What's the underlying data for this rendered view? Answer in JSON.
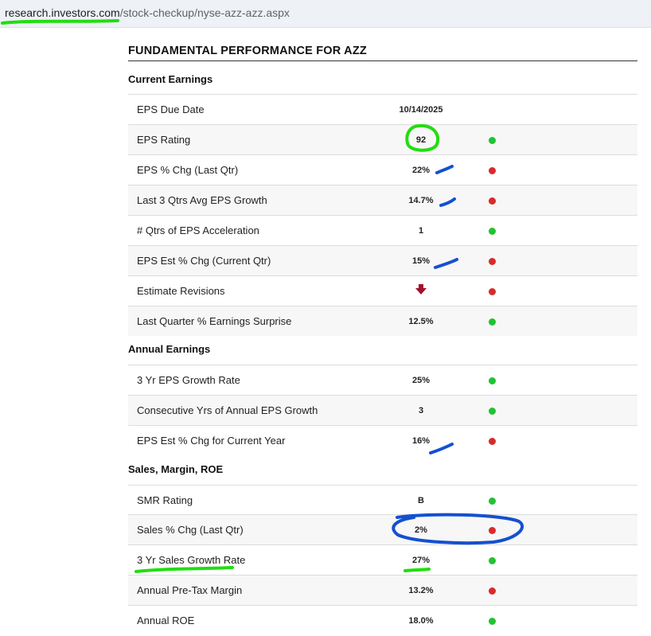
{
  "browser": {
    "url_host": "research.investors.com",
    "url_path": "/stock-checkup/nyse-azz-azz.aspx"
  },
  "page": {
    "title": "FUNDAMENTAL PERFORMANCE FOR AZZ"
  },
  "colors": {
    "good": "#22c232",
    "bad": "#d92b2b",
    "down_arrow": "#a3102a",
    "ink_green": "#22dd11",
    "ink_blue": "#1450d0"
  },
  "sections": {
    "current": {
      "heading": "Current Earnings",
      "rows": [
        {
          "label": "EPS Due Date",
          "value": "10/14/2025",
          "status": ""
        },
        {
          "label": "EPS Rating",
          "value": "92",
          "status": "good"
        },
        {
          "label": "EPS % Chg (Last Qtr)",
          "value": "22%",
          "status": "bad"
        },
        {
          "label": "Last 3 Qtrs Avg EPS Growth",
          "value": "14.7%",
          "status": "bad"
        },
        {
          "label": "# Qtrs of EPS Acceleration",
          "value": "1",
          "status": "good"
        },
        {
          "label": "EPS Est % Chg (Current Qtr)",
          "value": "15%",
          "status": "bad"
        },
        {
          "label": "Estimate Revisions",
          "value": "",
          "icon": "down-arrow-icon",
          "status": "bad"
        },
        {
          "label": "Last Quarter % Earnings Surprise",
          "value": "12.5%",
          "status": "good"
        }
      ]
    },
    "annual": {
      "heading": "Annual Earnings",
      "rows": [
        {
          "label": "3 Yr EPS Growth Rate",
          "value": "25%",
          "status": "good"
        },
        {
          "label": "Consecutive Yrs of Annual EPS Growth",
          "value": "3",
          "status": "good"
        },
        {
          "label": "EPS Est % Chg for Current Year",
          "value": "16%",
          "status": "bad"
        }
      ]
    },
    "smr": {
      "heading": "Sales, Margin, ROE",
      "rows": [
        {
          "label": "SMR Rating",
          "value": "B",
          "status": "good"
        },
        {
          "label": "Sales % Chg (Last Qtr)",
          "value": "2%",
          "status": "bad"
        },
        {
          "label": "3 Yr Sales Growth Rate",
          "value": "27%",
          "status": "good"
        },
        {
          "label": "Annual Pre-Tax Margin",
          "value": "13.2%",
          "status": "bad"
        },
        {
          "label": "Annual ROE",
          "value": "18.0%",
          "status": "good"
        }
      ]
    }
  }
}
